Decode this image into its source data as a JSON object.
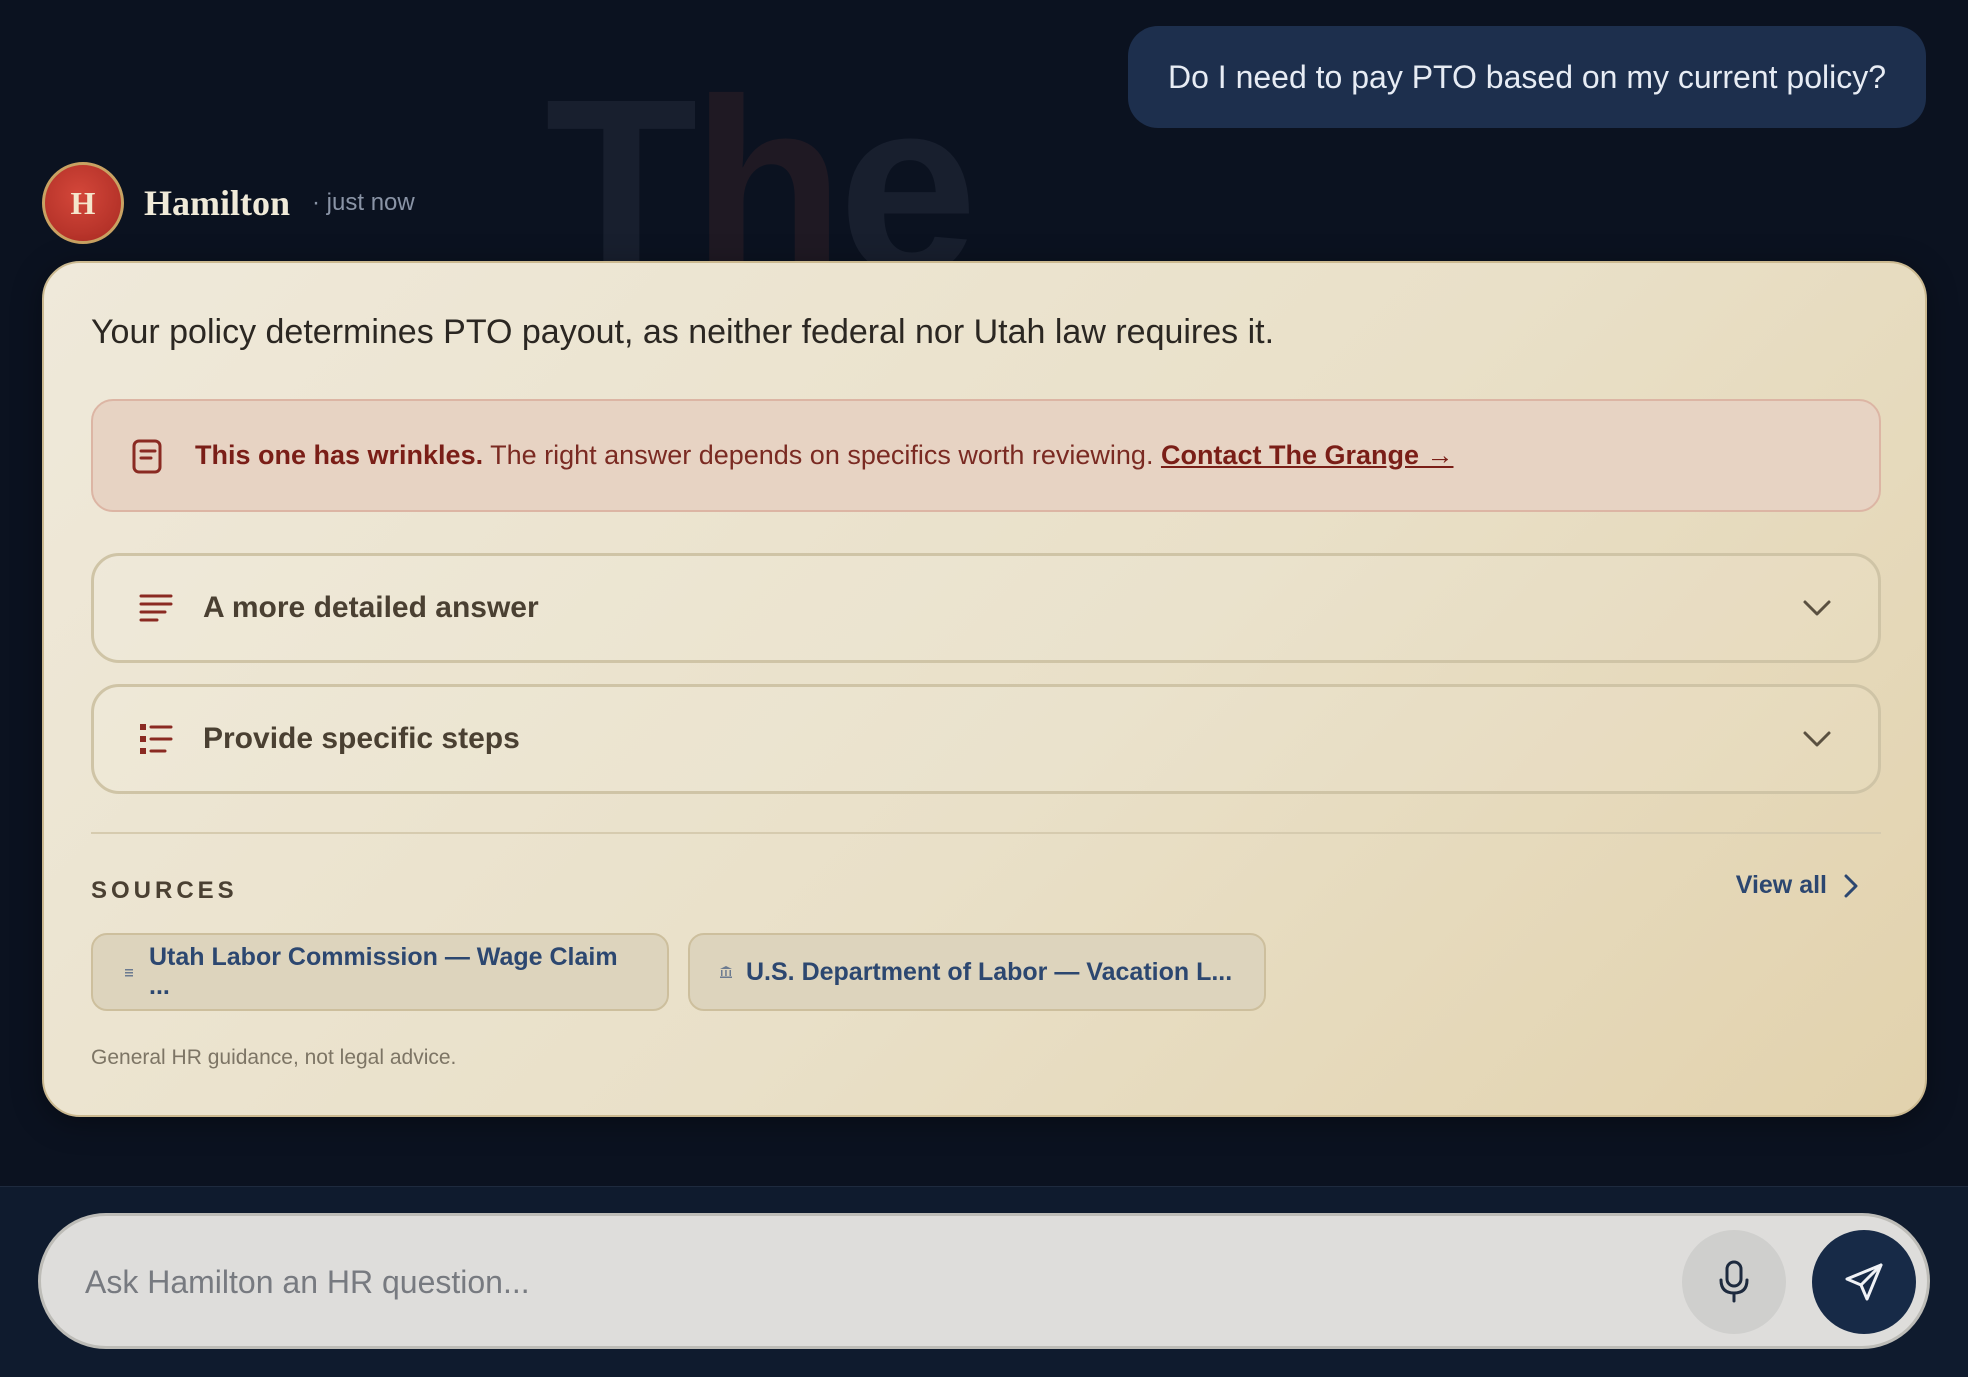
{
  "watermark": {
    "text_a": "T",
    "text_b": "h",
    "text_c": "e"
  },
  "user_message": {
    "text": "Do I need to pay PTO based on my current policy?"
  },
  "assistant": {
    "avatar_initial": "H",
    "name": "Hamilton",
    "timestamp": "· just now"
  },
  "response": {
    "answer": "Your policy determines PTO payout, as neither federal nor Utah law requires it.",
    "alert": {
      "icon": "document-icon",
      "bold": "This one has wrinkles.",
      "text": " The right answer depends on specifics worth reviewing. ",
      "link": "Contact The Grange →"
    },
    "accordions": [
      {
        "label": "A more detailed answer",
        "icon": "lines-icon"
      },
      {
        "label": "Provide specific steps",
        "icon": "list-icon"
      }
    ],
    "sources": {
      "title": "SOURCES",
      "view_all": "View all",
      "items": [
        {
          "label": "Utah Labor Commission — Wage Claim ...",
          "icon": "favicon-icon"
        },
        {
          "label": "U.S. Department of Labor — Vacation L...",
          "icon": "building-icon"
        }
      ]
    },
    "disclaimer": "General HR guidance, not legal advice."
  },
  "composer": {
    "placeholder": "Ask Hamilton an HR question...",
    "mic_icon": "microphone-icon",
    "send_icon": "send-icon"
  },
  "colors": {
    "background": "#0b1220",
    "user_bubble": "#1d2f4d",
    "accent_red": "#7a1e17",
    "link_blue": "#2c4770",
    "send_button": "#172a47"
  }
}
